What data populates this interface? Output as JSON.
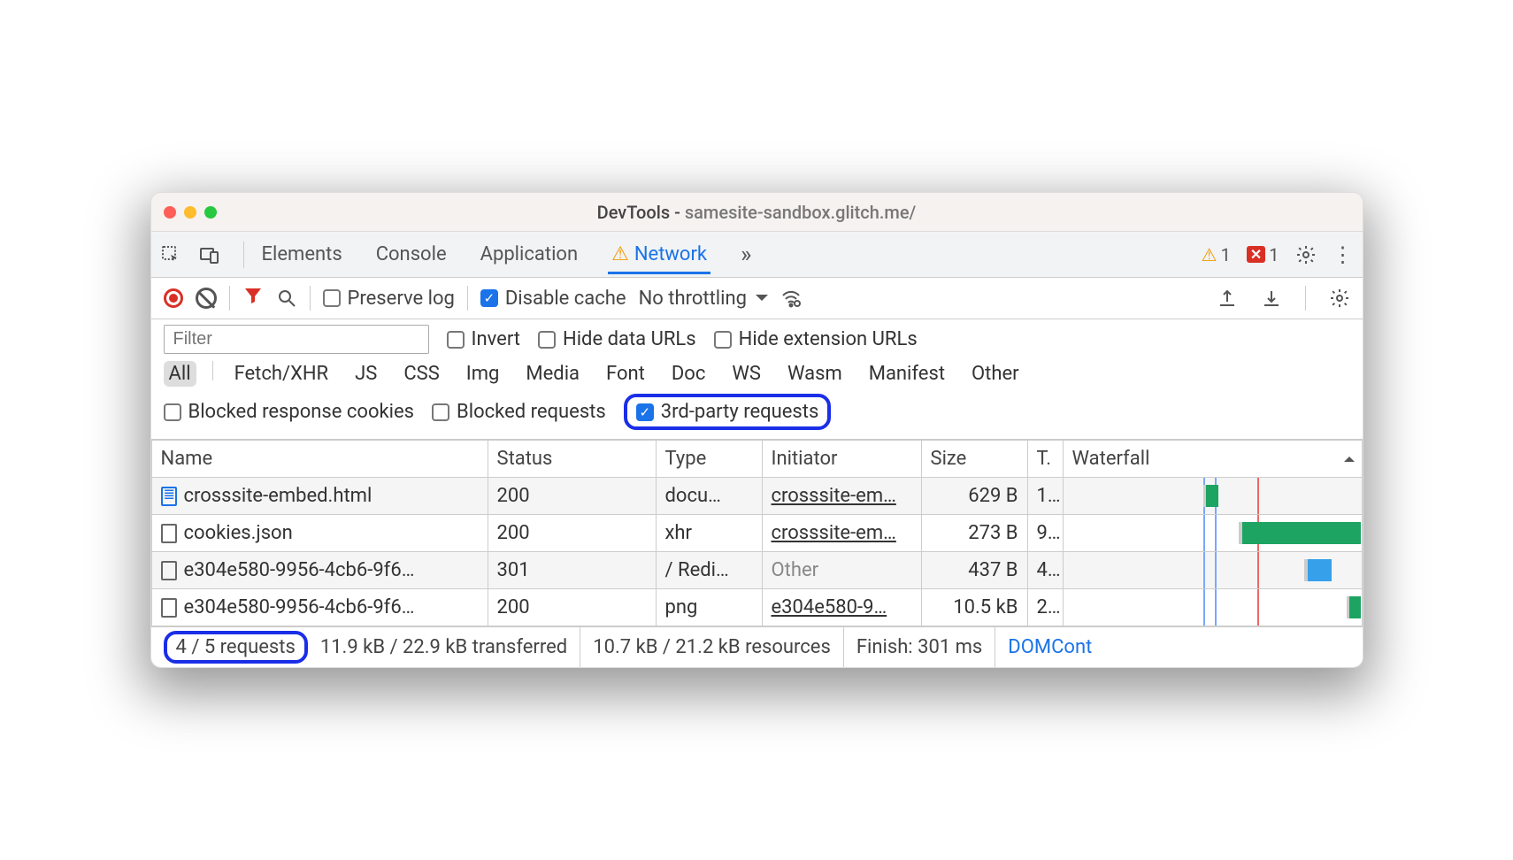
{
  "title": {
    "prefix": "DevTools - ",
    "url": "samesite-sandbox.glitch.me/"
  },
  "mainTabs": {
    "items": [
      "Elements",
      "Console",
      "Application",
      "Network"
    ],
    "active": "Network",
    "warnings": "1",
    "errors": "1"
  },
  "toolbar": {
    "preserveLog": {
      "label": "Preserve log",
      "checked": false
    },
    "disableCache": {
      "label": "Disable cache",
      "checked": true
    },
    "throttling": "No throttling"
  },
  "filters": {
    "placeholder": "Filter",
    "invert": {
      "label": "Invert",
      "checked": false
    },
    "hideData": {
      "label": "Hide data URLs",
      "checked": false
    },
    "hideExt": {
      "label": "Hide extension URLs",
      "checked": false
    },
    "types": [
      "All",
      "Fetch/XHR",
      "JS",
      "CSS",
      "Img",
      "Media",
      "Font",
      "Doc",
      "WS",
      "Wasm",
      "Manifest",
      "Other"
    ],
    "typeSelected": "All",
    "blockedCookies": {
      "label": "Blocked response cookies",
      "checked": false
    },
    "blockedReq": {
      "label": "Blocked requests",
      "checked": false
    },
    "thirdParty": {
      "label": "3rd-party requests",
      "checked": true
    }
  },
  "columns": {
    "name": "Name",
    "status": "Status",
    "type": "Type",
    "initiator": "Initiator",
    "size": "Size",
    "time": "T.",
    "waterfall": "Waterfall"
  },
  "rows": [
    {
      "icon": "doc",
      "name": "crosssite-embed.html",
      "status": "200",
      "type": "docu…",
      "initiator": "crosssite-em…",
      "initLink": true,
      "size": "629 B",
      "time": "1..",
      "wf": {
        "start": 48,
        "w": 4,
        "green": true
      }
    },
    {
      "icon": "generic",
      "name": "cookies.json",
      "status": "200",
      "type": "xhr",
      "initiator": "crosssite-em…",
      "initLink": true,
      "size": "273 B",
      "time": "9..",
      "wf": {
        "start": 60,
        "w": 40,
        "green": true
      }
    },
    {
      "icon": "generic",
      "name": "e304e580-9956-4cb6-9f6…",
      "status": "301",
      "type": "/ Redi…",
      "initiator": "Other",
      "initLink": false,
      "size": "437 B",
      "time": "4..",
      "wf": {
        "start": 82,
        "w": 8,
        "green": true,
        "blue": true
      }
    },
    {
      "icon": "generic",
      "name": "e304e580-9956-4cb6-9f6…",
      "status": "200",
      "type": "png",
      "initiator": "e304e580-9…",
      "initLink": true,
      "size": "10.5 kB",
      "time": "2..",
      "wf": {
        "start": 96,
        "w": 4,
        "green": true
      }
    }
  ],
  "timeline": {
    "blueStart": 47,
    "blueEnd": 51,
    "redAt": 65
  },
  "status": {
    "requests": "4 / 5 requests",
    "transferred": "11.9 kB / 22.9 kB transferred",
    "resources": "10.7 kB / 21.2 kB resources",
    "finish": "Finish: 301 ms",
    "domcontent": "DOMCont"
  }
}
